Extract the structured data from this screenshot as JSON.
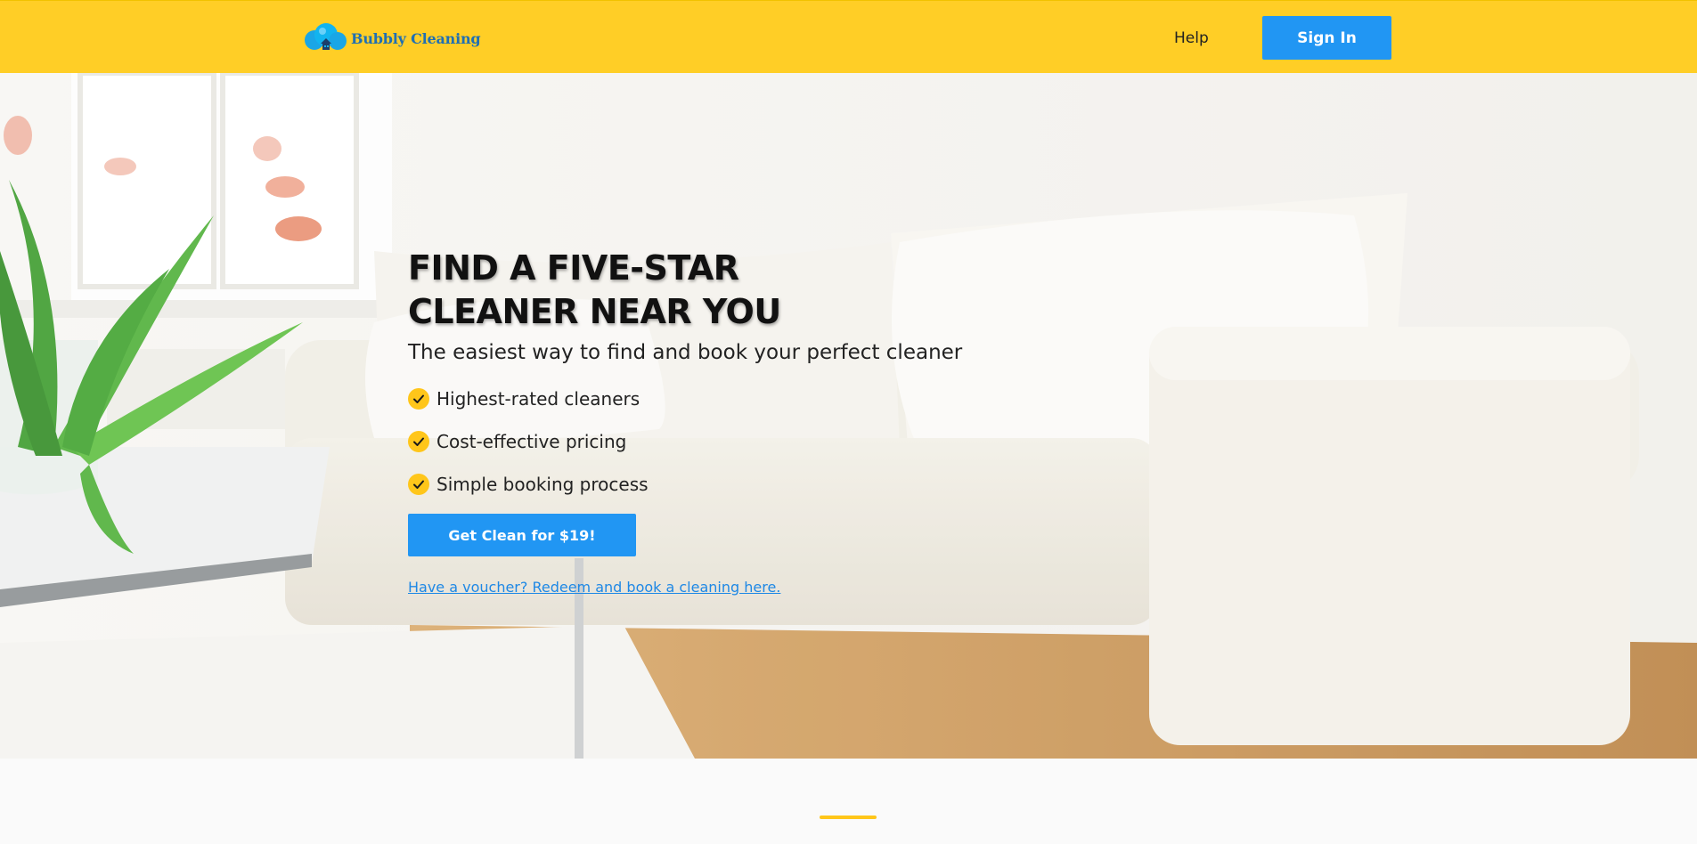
{
  "header": {
    "logo_text": "Bubbly Cleaning",
    "help_label": "Help",
    "signin_label": "Sign In"
  },
  "hero": {
    "title_line1": "FIND A FIVE-STAR",
    "title_line2": "CLEANER NEAR YOU",
    "subtitle": "The easiest way to find and book your perfect cleaner",
    "features": [
      "Highest-rated cleaners",
      "Cost-effective pricing",
      "Simple booking process"
    ],
    "cta_label": "Get Clean for $19!",
    "voucher_link": "Have a voucher? Redeem and book a cleaning here."
  },
  "colors": {
    "brand_yellow": "#ffce26",
    "button_blue": "#2196f3",
    "link_blue": "#1e88e5",
    "check_yellow": "#ffc61a"
  },
  "icons": [
    "logo-bubbles-house-icon",
    "checkmark-icon"
  ]
}
